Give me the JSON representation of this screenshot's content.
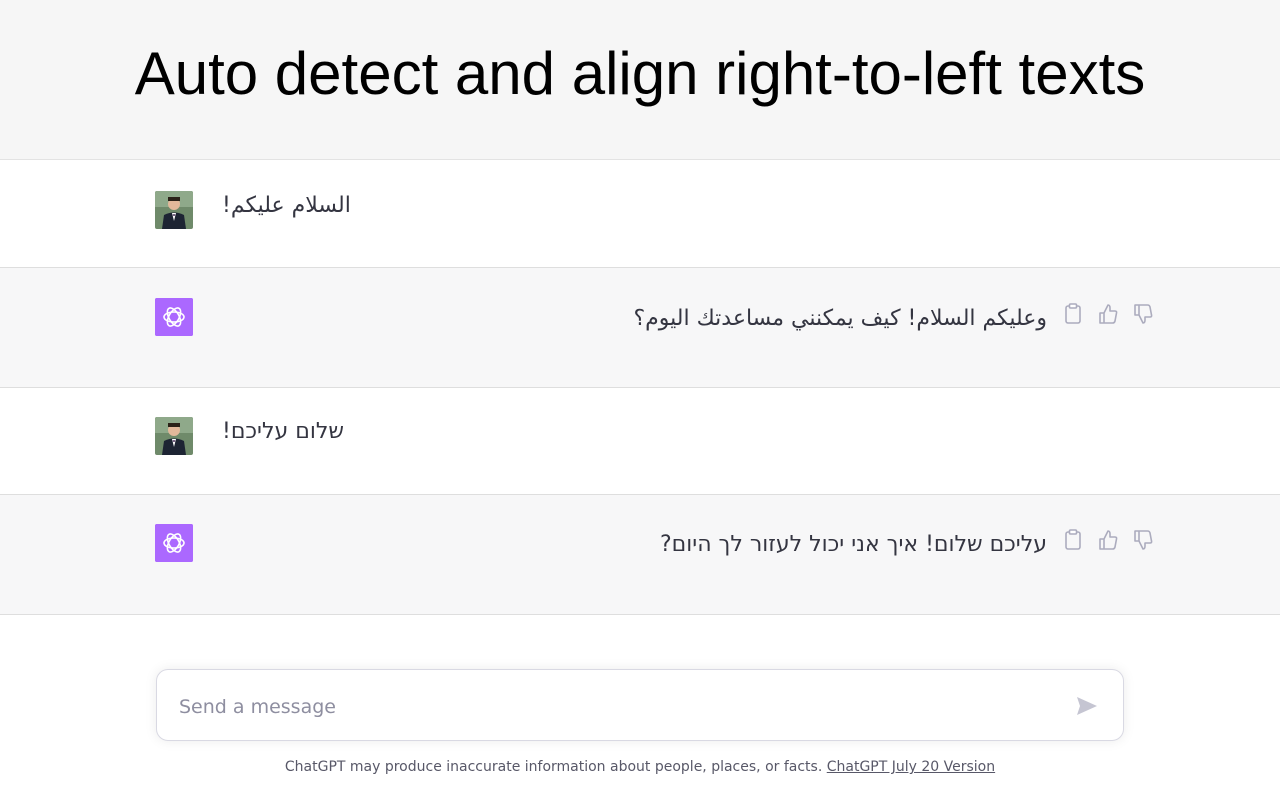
{
  "header": {
    "title": "Auto detect and align right-to-left texts"
  },
  "messages": [
    {
      "role": "user",
      "text": "السلام عليكم!"
    },
    {
      "role": "assistant",
      "text": "وعليكم السلام! كيف يمكنني مساعدتك اليوم؟"
    },
    {
      "role": "user",
      "text": "שלום עליכם!"
    },
    {
      "role": "assistant",
      "text": "עליכם שלום! איך אני יכול לעזור לך היום?"
    }
  ],
  "composer": {
    "placeholder": "Send a message"
  },
  "footer": {
    "text": "ChatGPT may produce inaccurate information about people, places, or facts. ",
    "link": "ChatGPT July 20 Version"
  },
  "colors": {
    "assistant_avatar": "#ab68ff",
    "header_bg": "#f6f6f6",
    "assistant_bg": "#f7f7f8"
  },
  "icons": {
    "user_avatar": "user-photo-icon",
    "assistant_avatar": "openai-logo-icon",
    "copy": "clipboard-icon",
    "like": "thumbs-up-icon",
    "dislike": "thumbs-down-icon",
    "send": "paper-plane-icon"
  }
}
